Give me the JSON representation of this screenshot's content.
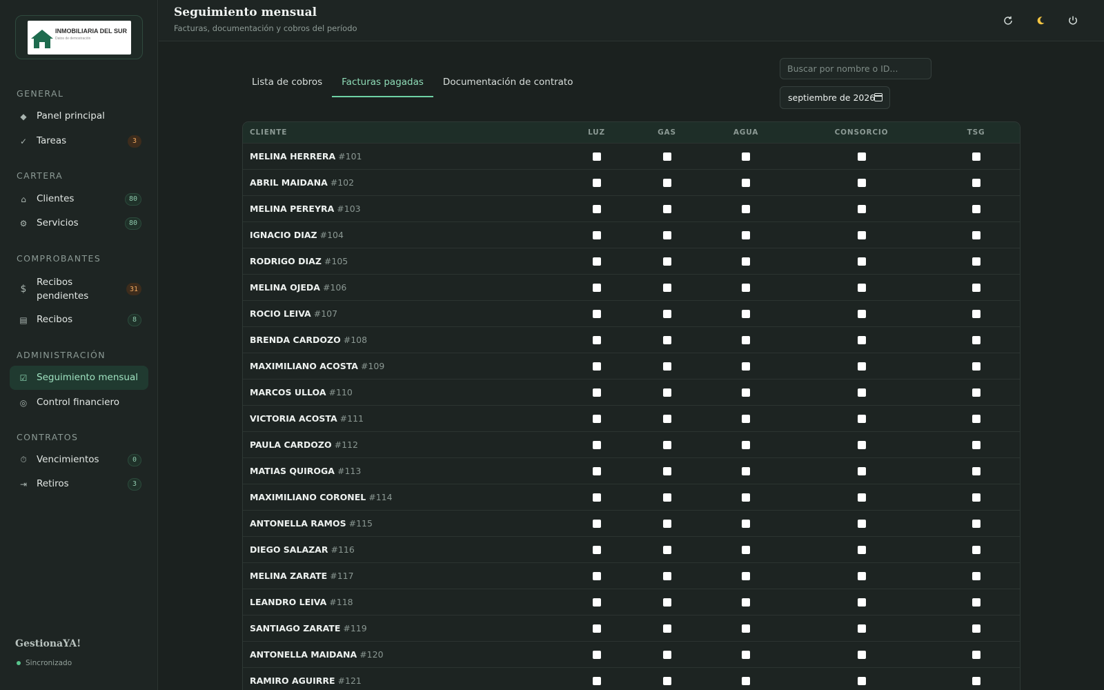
{
  "sidebar": {
    "logo": {
      "title": "INMOBILIARIA DEL SUR",
      "subtitle": "Datos de demostración"
    },
    "sections": [
      {
        "title": "General",
        "items": [
          {
            "icon": "diamond-icon",
            "label": "Panel principal",
            "badge": null
          },
          {
            "icon": "check-icon",
            "label": "Tareas",
            "badge": "3",
            "badge_type": "warn"
          }
        ]
      },
      {
        "title": "Cartera",
        "items": [
          {
            "icon": "home-icon",
            "label": "Clientes",
            "badge": "80",
            "badge_type": "ok"
          },
          {
            "icon": "gear-icon",
            "label": "Servicios",
            "badge": "80",
            "badge_type": "ok"
          }
        ]
      },
      {
        "title": "Comprobantes",
        "items": [
          {
            "icon": "dollar-icon",
            "label": "Recibos pendientes",
            "badge": "31",
            "badge_type": "warn"
          },
          {
            "icon": "receipt-icon",
            "label": "Recibos",
            "badge": "8",
            "badge_type": "ok"
          }
        ]
      },
      {
        "title": "Administración",
        "items": [
          {
            "icon": "checkbox-icon",
            "label": "Seguimiento mensual",
            "badge": null,
            "active": true
          },
          {
            "icon": "target-icon",
            "label": "Control financiero",
            "badge": null
          }
        ]
      },
      {
        "title": "Contratos",
        "items": [
          {
            "icon": "clock-icon",
            "label": "Vencimientos",
            "badge": "0",
            "badge_type": "ok"
          },
          {
            "icon": "exit-icon",
            "label": "Retiros",
            "badge": "3",
            "badge_type": "ok"
          }
        ]
      }
    ],
    "brand": "GestionaYA!",
    "sync_status": "Sincronizado"
  },
  "header": {
    "title": "Seguimiento mensual",
    "subtitle": "Facturas, documentación y cobros del período",
    "actions": [
      "refresh-icon",
      "moon-icon",
      "power-icon"
    ]
  },
  "tabs": [
    {
      "label": "Lista de cobros",
      "active": false
    },
    {
      "label": "Facturas pagadas",
      "active": true
    },
    {
      "label": "Documentación de contrato",
      "active": false
    }
  ],
  "search": {
    "placeholder": "Buscar por nombre o ID...",
    "value": ""
  },
  "month_picker": {
    "value": "septiembre de 2026"
  },
  "table": {
    "columns": [
      "CLIENTE",
      "LUZ",
      "GAS",
      "AGUA",
      "CONSORCIO",
      "TSG"
    ],
    "rows": [
      {
        "name": "MELINA HERRERA",
        "id": "#101"
      },
      {
        "name": "ABRIL MAIDANA",
        "id": "#102"
      },
      {
        "name": "MELINA PEREYRA",
        "id": "#103"
      },
      {
        "name": "IGNACIO DIAZ",
        "id": "#104"
      },
      {
        "name": "RODRIGO DIAZ",
        "id": "#105"
      },
      {
        "name": "MELINA OJEDA",
        "id": "#106"
      },
      {
        "name": "ROCIO LEIVA",
        "id": "#107"
      },
      {
        "name": "BRENDA CARDOZO",
        "id": "#108"
      },
      {
        "name": "MAXIMILIANO ACOSTA",
        "id": "#109"
      },
      {
        "name": "MARCOS ULLOA",
        "id": "#110"
      },
      {
        "name": "VICTORIA ACOSTA",
        "id": "#111"
      },
      {
        "name": "PAULA CARDOZO",
        "id": "#112"
      },
      {
        "name": "MATIAS QUIROGA",
        "id": "#113"
      },
      {
        "name": "MAXIMILIANO CORONEL",
        "id": "#114"
      },
      {
        "name": "ANTONELLA RAMOS",
        "id": "#115"
      },
      {
        "name": "DIEGO SALAZAR",
        "id": "#116"
      },
      {
        "name": "MELINA ZARATE",
        "id": "#117"
      },
      {
        "name": "LEANDRO LEIVA",
        "id": "#118"
      },
      {
        "name": "SANTIAGO ZARATE",
        "id": "#119"
      },
      {
        "name": "ANTONELLA MAIDANA",
        "id": "#120"
      },
      {
        "name": "RAMIRO AGUIRRE",
        "id": "#121"
      }
    ]
  }
}
